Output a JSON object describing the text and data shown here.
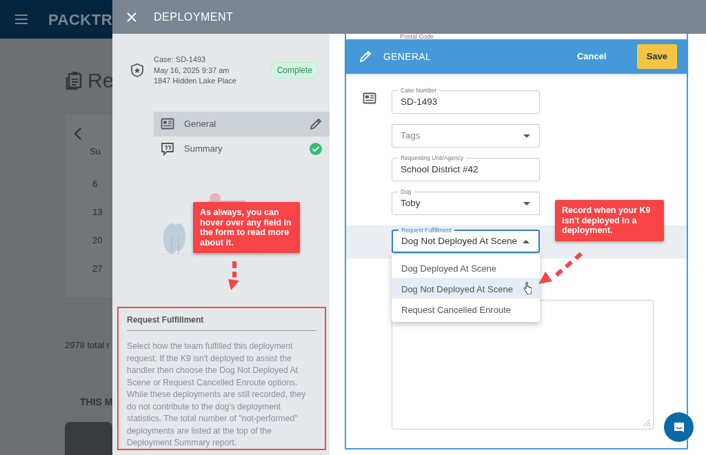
{
  "background_app": {
    "logo": "PACKTR",
    "page_title": "Re",
    "calendar": {
      "weekday": "Su",
      "days": [
        "6",
        "13",
        "20",
        "27"
      ]
    },
    "total": "2978 total r",
    "section_title": "THIS M"
  },
  "drawer": {
    "title": "DEPLOYMENT",
    "case": {
      "lines": [
        "Case: SD-1493",
        "May 16, 2025 9:37 am",
        "1847 Hidden Lake Place"
      ],
      "status": "Complete"
    },
    "sections": [
      {
        "label": "General",
        "selected": true,
        "kind": "editing"
      },
      {
        "label": "Summary",
        "selected": false,
        "kind": "done"
      }
    ],
    "help": {
      "title": "Request Fulfillment",
      "body": "Select how the team fulfilled this deployment request. If the K9 isn't deployed to assist the handler then choose the Dog Not Deployed At Scene or Request Cancelled Enroute options. While these deployments are still recorded, they do not contribute to the dog's deployment statistics. The total number of \"not-performed\" deployments are listed at the top of the Deployment Summary report."
    }
  },
  "form": {
    "hidden_label": "Postal Code",
    "title": "GENERAL",
    "cancel": "Cancel",
    "save": "Save",
    "fields": [
      {
        "kind": "text",
        "label": "Case Number",
        "value": "SD-1493",
        "focused": false
      },
      {
        "kind": "select",
        "placeholder": "Tags",
        "expanded": false,
        "focused": false
      },
      {
        "kind": "text",
        "label": "Requesting Unit/Agency",
        "value": "School District #42",
        "focused": false
      },
      {
        "kind": "select",
        "label": "Dog",
        "value": "Toby",
        "expanded": false,
        "focused": false
      },
      {
        "kind": "select",
        "label": "Request Fulfillment",
        "value": "Dog Not Deployed At Scene",
        "expanded": true,
        "focused": true,
        "options": [
          {
            "label": "Dog Deployed At Scene",
            "selected": false
          },
          {
            "label": "Dog Not Deployed At Scene",
            "selected": true
          },
          {
            "label": "Request Cancelled Enroute",
            "selected": false
          }
        ]
      },
      {
        "kind": "textarea",
        "focused": false
      }
    ]
  },
  "callouts": [
    {
      "text": "As always, you can hover over any field in the form to read more about it."
    },
    {
      "text": "Record when your K9 isn't deployed in a deployment."
    }
  ]
}
